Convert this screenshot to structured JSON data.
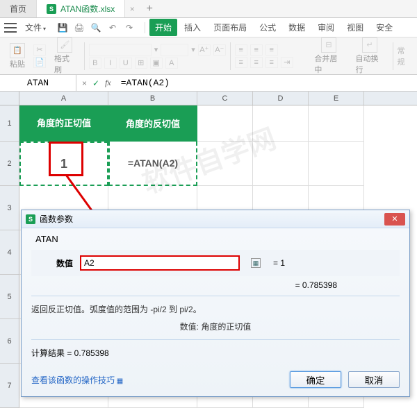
{
  "titlebar": {
    "home_tab": "首页",
    "filename": "ATAN函数.xlsx",
    "close_glyph": "×",
    "plus_glyph": "+"
  },
  "menu": {
    "file": "文件",
    "tabs": [
      "开始",
      "插入",
      "页面布局",
      "公式",
      "数据",
      "审阅",
      "视图",
      "安全"
    ],
    "active_tab_index": 0
  },
  "ribbon": {
    "paste": "粘贴",
    "format_brush": "格式刷",
    "merge_center": "合并居中",
    "auto_wrap": "自动换行",
    "general": "常规"
  },
  "formulabar": {
    "namebox": "ATAN",
    "formula": "=ATAN(A2)"
  },
  "sheet": {
    "cols": [
      "A",
      "B",
      "C",
      "D",
      "E"
    ],
    "rows": [
      "1",
      "2",
      "3",
      "4",
      "5",
      "6",
      "7"
    ],
    "header_a1": "角度的正切值",
    "header_b1": "角度的反切值",
    "a2": "1",
    "b2": "=ATAN(A2)"
  },
  "dialog": {
    "title": "函数参数",
    "fn_name": "ATAN",
    "param_label": "数值",
    "param_value": "A2",
    "param_eq": "= 1",
    "computed": "= 0.785398",
    "desc": "返回反正切值。弧度值的范围为 -pi/2 到 pi/2。",
    "desc_sub": "数值:  角度的正切值",
    "calc_result": "计算结果  = 0.785398",
    "help_link": "查看该函数的操作技巧",
    "ok": "确定",
    "cancel": "取消"
  },
  "watermark": "软件自学网"
}
